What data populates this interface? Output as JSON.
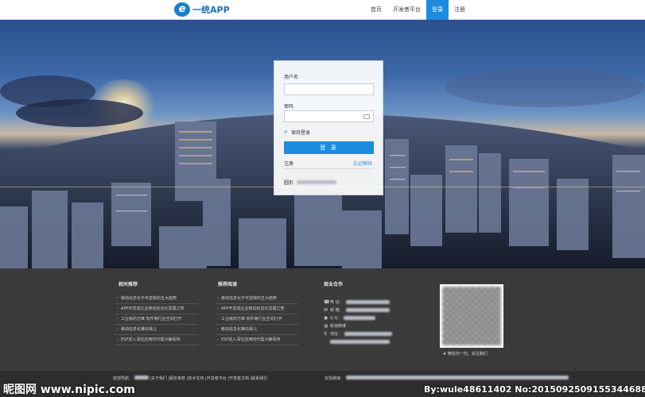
{
  "header": {
    "logo_text": "一统APP",
    "logo_mark": "e",
    "nav": [
      "首页",
      "开发者平台",
      "登录",
      "注册"
    ],
    "active_nav": "登录"
  },
  "login": {
    "username_label": "用户名",
    "password_label": "密码",
    "remember_label": "保持登录",
    "submit_label": "登 录",
    "register_label": "注册",
    "forgot_label": "忘记密码",
    "bottom_label": "圆形"
  },
  "footer": {
    "related_title": "相关推荐",
    "related_items": [
      "移动信息化不可逆转的五大趋势",
      "APP开发成企业移动信息化发展之势",
      "工业级的方维 软件等行业空间打开",
      "移动信息化推动事儿",
      "ESP进入深化应用时代需冷静看待"
    ],
    "reading_title": "推荐阅读",
    "reading_items": [
      "移动信息化不可逆转的五大趋势",
      "APP开发成企业移动信息化发展之势",
      "工业级的方维 软件等行业空间打开",
      "移动信息化推动事儿",
      "ESP进入深化应用时代需冷静看待"
    ],
    "biz_title": "商业合作",
    "biz_rows": [
      {
        "icon": "☎",
        "label": "电 话："
      },
      {
        "icon": "✉",
        "label": "邮 箱："
      },
      {
        "icon": "◉",
        "label": "Q Q："
      },
      {
        "icon": "◍",
        "label": "新浪微博"
      },
      {
        "icon": "⚲",
        "label": "地址："
      }
    ],
    "wechat_label": "微信扫一扫，关注我们",
    "bottom_left": "底部导航：",
    "bottom_left_links": "|关于我们 |服务条款 |技术支持 |开发者平台 |开发者文档 |联系我们",
    "bottom_right": "友情链接："
  },
  "watermark": {
    "left": "昵图网 www.nipic.com",
    "right": "By:wule48611402 No:20150925091553446881"
  }
}
